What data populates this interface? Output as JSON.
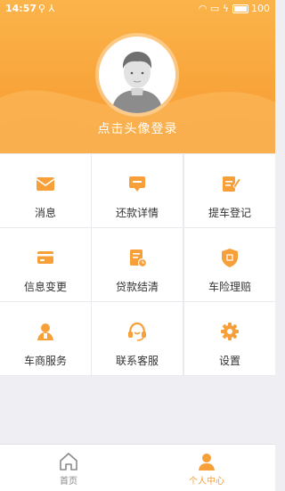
{
  "status_bar": {
    "time": "14:57",
    "battery": "100"
  },
  "profile": {
    "login_prompt": "点击头像登录"
  },
  "menu": [
    {
      "label": "消息",
      "icon": "envelope-icon"
    },
    {
      "label": "还款详情",
      "icon": "chat-card-icon"
    },
    {
      "label": "提车登记",
      "icon": "register-icon"
    },
    {
      "label": "信息变更",
      "icon": "card-icon"
    },
    {
      "label": "贷款结清",
      "icon": "document-clock-icon"
    },
    {
      "label": "车险理赔",
      "icon": "shield-icon"
    },
    {
      "label": "车商服务",
      "icon": "dealer-person-icon"
    },
    {
      "label": "联系客服",
      "icon": "headset-icon"
    },
    {
      "label": "设置",
      "icon": "gear-icon"
    }
  ],
  "tabs": [
    {
      "label": "首页",
      "icon": "home-icon",
      "active": false
    },
    {
      "label": "个人中心",
      "icon": "user-icon",
      "active": true
    }
  ],
  "colors": {
    "accent": "#f7a03a",
    "inactive_tab": "#888888",
    "text": "#333333"
  }
}
